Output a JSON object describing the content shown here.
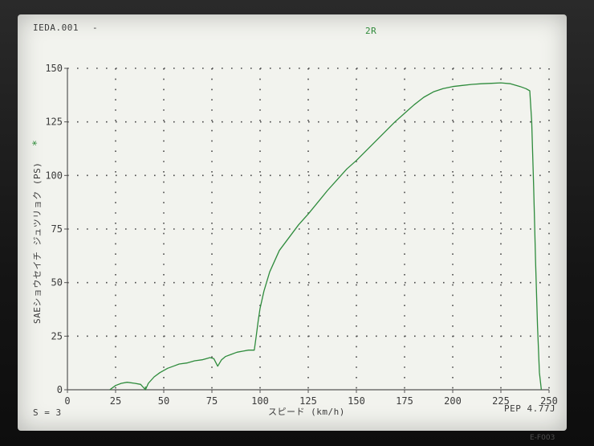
{
  "header": {
    "file_name": "IEDA.001",
    "file_dash": "-",
    "run_code": "2R",
    "star": "*"
  },
  "footer": {
    "left_text": "S = 3",
    "right_text": "PEP 4.77J"
  },
  "watermark": "E-F003",
  "colors": {
    "screen": "#f2f3ee",
    "curve": "#2e8b3c",
    "grid": "#4a4a4a",
    "text": "#3b3b3b"
  },
  "chart_data": {
    "type": "line",
    "title": "",
    "xlabel": "スピード (km/h)",
    "ylabel": "SAEショウセイチ ジュツリョク (PS)",
    "xlim": [
      0,
      250
    ],
    "ylim": [
      0,
      150
    ],
    "xticks": [
      0,
      25,
      50,
      75,
      100,
      125,
      150,
      175,
      200,
      225,
      250
    ],
    "yticks": [
      0,
      25,
      50,
      75,
      100,
      125,
      150
    ],
    "grid": true,
    "series": [
      {
        "x": [
          22,
          25,
          28,
          31,
          35,
          38,
          40.5,
          42,
          45,
          48,
          52,
          55,
          58,
          62,
          66,
          70,
          74,
          76,
          78,
          80,
          82,
          85,
          88,
          91,
          94,
          97,
          98,
          99,
          100,
          102,
          105,
          110,
          115,
          120,
          125,
          130,
          135,
          140,
          145,
          150,
          155,
          160,
          165,
          170,
          175,
          180,
          185,
          190,
          195,
          200,
          205,
          210,
          215,
          220,
          225,
          230,
          235,
          238,
          240,
          241,
          242,
          243,
          244,
          245,
          246
        ],
        "y": [
          0,
          2,
          3,
          3.5,
          3,
          2.5,
          0,
          3,
          6,
          8,
          10,
          11,
          12,
          12.5,
          13.5,
          14,
          15,
          14.5,
          11,
          14,
          15.5,
          16.5,
          17.5,
          18,
          18.5,
          18.5,
          25,
          32,
          38,
          46,
          55,
          65,
          71,
          77,
          82,
          87.5,
          93,
          98,
          103,
          107,
          111.5,
          116,
          120.5,
          125,
          129,
          133,
          136.5,
          139,
          140.5,
          141.5,
          142,
          142.5,
          142.8,
          143,
          143.2,
          142.8,
          141.5,
          140.5,
          139.5,
          125,
          95,
          60,
          30,
          8,
          0
        ]
      },
      {
        "x": [
          40.5,
          40.5
        ],
        "y": [
          0,
          1.5
        ]
      }
    ]
  }
}
